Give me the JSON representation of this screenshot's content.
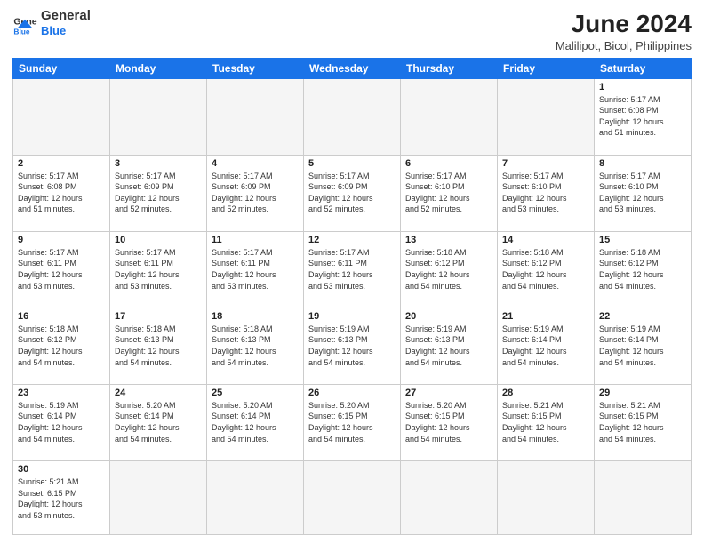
{
  "logo": {
    "text_general": "General",
    "text_blue": "Blue"
  },
  "title": "June 2024",
  "subtitle": "Malilipot, Bicol, Philippines",
  "header_days": [
    "Sunday",
    "Monday",
    "Tuesday",
    "Wednesday",
    "Thursday",
    "Friday",
    "Saturday"
  ],
  "weeks": [
    [
      {
        "day": "",
        "info": ""
      },
      {
        "day": "",
        "info": ""
      },
      {
        "day": "",
        "info": ""
      },
      {
        "day": "",
        "info": ""
      },
      {
        "day": "",
        "info": ""
      },
      {
        "day": "",
        "info": ""
      },
      {
        "day": "1",
        "info": "Sunrise: 5:17 AM\nSunset: 6:08 PM\nDaylight: 12 hours\nand 51 minutes."
      }
    ],
    [
      {
        "day": "2",
        "info": "Sunrise: 5:17 AM\nSunset: 6:08 PM\nDaylight: 12 hours\nand 51 minutes."
      },
      {
        "day": "3",
        "info": "Sunrise: 5:17 AM\nSunset: 6:09 PM\nDaylight: 12 hours\nand 52 minutes."
      },
      {
        "day": "4",
        "info": "Sunrise: 5:17 AM\nSunset: 6:09 PM\nDaylight: 12 hours\nand 52 minutes."
      },
      {
        "day": "5",
        "info": "Sunrise: 5:17 AM\nSunset: 6:09 PM\nDaylight: 12 hours\nand 52 minutes."
      },
      {
        "day": "6",
        "info": "Sunrise: 5:17 AM\nSunset: 6:10 PM\nDaylight: 12 hours\nand 52 minutes."
      },
      {
        "day": "7",
        "info": "Sunrise: 5:17 AM\nSunset: 6:10 PM\nDaylight: 12 hours\nand 53 minutes."
      },
      {
        "day": "8",
        "info": "Sunrise: 5:17 AM\nSunset: 6:10 PM\nDaylight: 12 hours\nand 53 minutes."
      }
    ],
    [
      {
        "day": "9",
        "info": "Sunrise: 5:17 AM\nSunset: 6:11 PM\nDaylight: 12 hours\nand 53 minutes."
      },
      {
        "day": "10",
        "info": "Sunrise: 5:17 AM\nSunset: 6:11 PM\nDaylight: 12 hours\nand 53 minutes."
      },
      {
        "day": "11",
        "info": "Sunrise: 5:17 AM\nSunset: 6:11 PM\nDaylight: 12 hours\nand 53 minutes."
      },
      {
        "day": "12",
        "info": "Sunrise: 5:17 AM\nSunset: 6:11 PM\nDaylight: 12 hours\nand 53 minutes."
      },
      {
        "day": "13",
        "info": "Sunrise: 5:18 AM\nSunset: 6:12 PM\nDaylight: 12 hours\nand 54 minutes."
      },
      {
        "day": "14",
        "info": "Sunrise: 5:18 AM\nSunset: 6:12 PM\nDaylight: 12 hours\nand 54 minutes."
      },
      {
        "day": "15",
        "info": "Sunrise: 5:18 AM\nSunset: 6:12 PM\nDaylight: 12 hours\nand 54 minutes."
      }
    ],
    [
      {
        "day": "16",
        "info": "Sunrise: 5:18 AM\nSunset: 6:12 PM\nDaylight: 12 hours\nand 54 minutes."
      },
      {
        "day": "17",
        "info": "Sunrise: 5:18 AM\nSunset: 6:13 PM\nDaylight: 12 hours\nand 54 minutes."
      },
      {
        "day": "18",
        "info": "Sunrise: 5:18 AM\nSunset: 6:13 PM\nDaylight: 12 hours\nand 54 minutes."
      },
      {
        "day": "19",
        "info": "Sunrise: 5:19 AM\nSunset: 6:13 PM\nDaylight: 12 hours\nand 54 minutes."
      },
      {
        "day": "20",
        "info": "Sunrise: 5:19 AM\nSunset: 6:13 PM\nDaylight: 12 hours\nand 54 minutes."
      },
      {
        "day": "21",
        "info": "Sunrise: 5:19 AM\nSunset: 6:14 PM\nDaylight: 12 hours\nand 54 minutes."
      },
      {
        "day": "22",
        "info": "Sunrise: 5:19 AM\nSunset: 6:14 PM\nDaylight: 12 hours\nand 54 minutes."
      }
    ],
    [
      {
        "day": "23",
        "info": "Sunrise: 5:19 AM\nSunset: 6:14 PM\nDaylight: 12 hours\nand 54 minutes."
      },
      {
        "day": "24",
        "info": "Sunrise: 5:20 AM\nSunset: 6:14 PM\nDaylight: 12 hours\nand 54 minutes."
      },
      {
        "day": "25",
        "info": "Sunrise: 5:20 AM\nSunset: 6:14 PM\nDaylight: 12 hours\nand 54 minutes."
      },
      {
        "day": "26",
        "info": "Sunrise: 5:20 AM\nSunset: 6:15 PM\nDaylight: 12 hours\nand 54 minutes."
      },
      {
        "day": "27",
        "info": "Sunrise: 5:20 AM\nSunset: 6:15 PM\nDaylight: 12 hours\nand 54 minutes."
      },
      {
        "day": "28",
        "info": "Sunrise: 5:21 AM\nSunset: 6:15 PM\nDaylight: 12 hours\nand 54 minutes."
      },
      {
        "day": "29",
        "info": "Sunrise: 5:21 AM\nSunset: 6:15 PM\nDaylight: 12 hours\nand 54 minutes."
      }
    ],
    [
      {
        "day": "30",
        "info": "Sunrise: 5:21 AM\nSunset: 6:15 PM\nDaylight: 12 hours\nand 53 minutes."
      },
      {
        "day": "",
        "info": ""
      },
      {
        "day": "",
        "info": ""
      },
      {
        "day": "",
        "info": ""
      },
      {
        "day": "",
        "info": ""
      },
      {
        "day": "",
        "info": ""
      },
      {
        "day": "",
        "info": ""
      }
    ]
  ]
}
